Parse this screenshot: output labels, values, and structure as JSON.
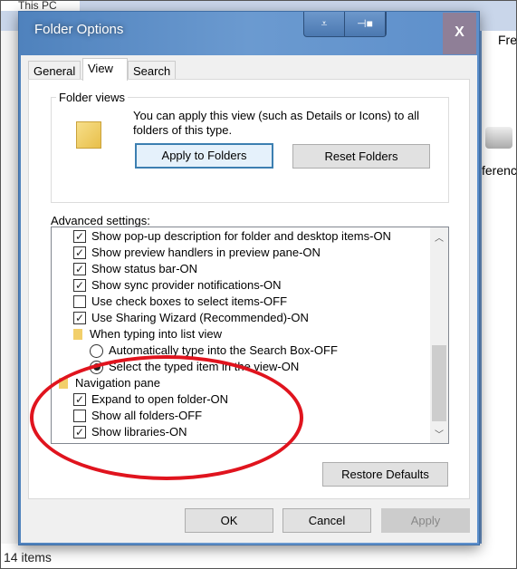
{
  "background": {
    "tab_title": "This PC",
    "right_text_top": "Fre",
    "right_text_mid": "ferenc",
    "status": "14 items"
  },
  "dialog": {
    "title": "Folder Options",
    "tabs": [
      {
        "label": "General"
      },
      {
        "label": "View",
        "active": true
      },
      {
        "label": "Search"
      }
    ],
    "folder_views": {
      "label": "Folder views",
      "text": "You can apply this view (such as Details or Icons) to all folders of this type.",
      "apply_label": "Apply to Folders",
      "reset_label": "Reset Folders"
    },
    "advanced_label": "Advanced settings:",
    "items": [
      {
        "type": "checkbox",
        "checked": true,
        "label": "Show pop-up description for folder and desktop items-ON"
      },
      {
        "type": "checkbox",
        "checked": true,
        "label": "Show preview handlers in preview pane-ON"
      },
      {
        "type": "checkbox",
        "checked": true,
        "label": "Show status bar-ON"
      },
      {
        "type": "checkbox",
        "checked": true,
        "label": "Show sync provider notifications-ON"
      },
      {
        "type": "checkbox",
        "checked": false,
        "label": "Use check boxes to select items-OFF"
      },
      {
        "type": "checkbox",
        "checked": true,
        "label": "Use Sharing Wizard (Recommended)-ON"
      },
      {
        "type": "folder",
        "label": "When typing into list view"
      },
      {
        "type": "radio",
        "checked": false,
        "label": "Automatically type into the Search Box-OFF"
      },
      {
        "type": "radio",
        "checked": true,
        "label": "Select the typed item in the view-ON"
      },
      {
        "type": "folder-root",
        "label": "Navigation pane"
      },
      {
        "type": "checkbox",
        "checked": true,
        "label": "Expand to open folder-ON"
      },
      {
        "type": "checkbox",
        "checked": false,
        "label": "Show all folders-OFF"
      },
      {
        "type": "checkbox",
        "checked": true,
        "label": "Show libraries-ON"
      }
    ],
    "restore_label": "Restore Defaults",
    "ok_label": "OK",
    "cancel_label": "Cancel",
    "apply_label": "Apply"
  },
  "colors": {
    "title_bar": "#5b8cc4",
    "annotation": "#e0141e"
  }
}
